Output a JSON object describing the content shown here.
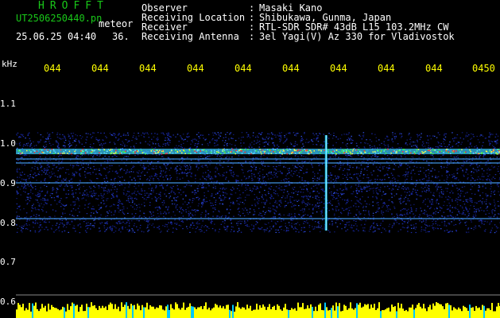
{
  "header": {
    "brand": "HROFFT",
    "filename": "UT2506250440.pn",
    "kind": "meteor",
    "datetime": "25.06.25 04:40",
    "count": "36.",
    "fields": [
      {
        "label": "Observer",
        "value": "Masaki Kano"
      },
      {
        "label": "Receiving Location",
        "value": "Shibukawa, Gunma, Japan"
      },
      {
        "label": "Receiver",
        "value": "RTL-SDR SDR# 43dB L15 103.2MHz CW"
      },
      {
        "label": "Receiving Antenna",
        "value": "3el Yagi(V) Az 330 for Vladivostok"
      }
    ]
  },
  "axis": {
    "unit": "kHz",
    "time_labels": [
      "044",
      "044",
      "044",
      "044",
      "044",
      "044",
      "044",
      "044",
      "044",
      "0450"
    ],
    "freq_labels": [
      "1.1",
      "1.0",
      "0.9",
      "0.8",
      "0.7",
      "0.6"
    ]
  },
  "spectrogram": {
    "freq_range_khz": [
      0.6,
      1.12
    ],
    "bands_khz": [
      0.98,
      0.96,
      0.95,
      0.9,
      0.81
    ],
    "burst_position_fraction": 0.64,
    "colors": {
      "noise": "#1a2aa8",
      "strong": "#00c8ff",
      "peak": "#ff3030",
      "mid": "#40ff40",
      "level": "#ffff00"
    }
  }
}
